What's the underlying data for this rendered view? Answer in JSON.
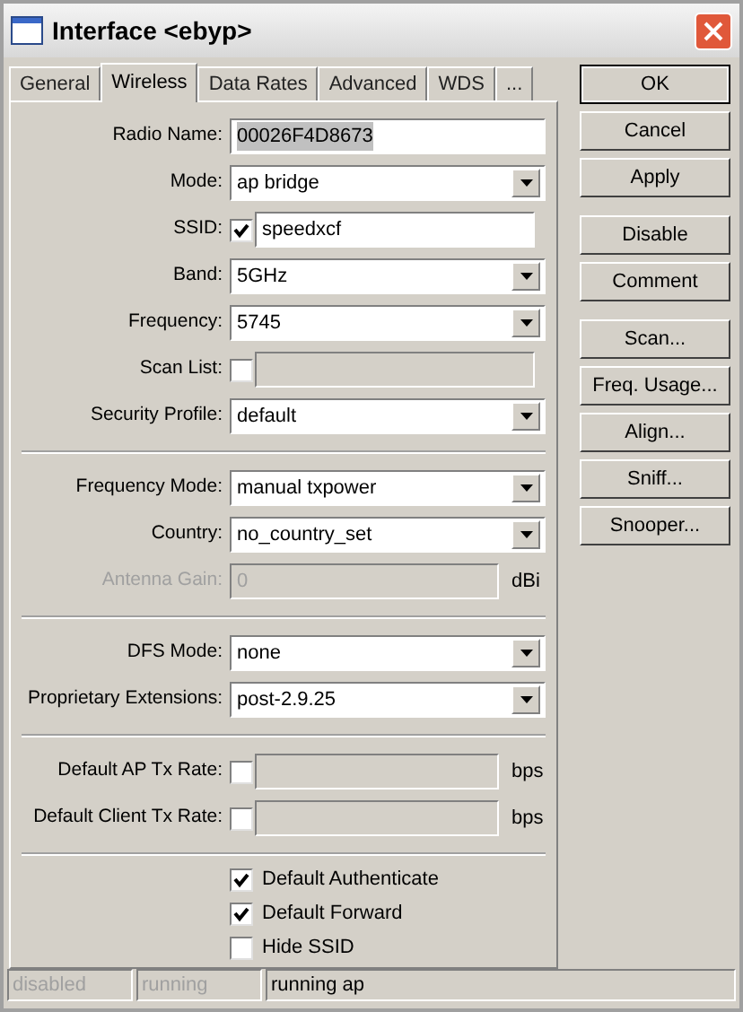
{
  "window": {
    "title": "Interface <ebyp>"
  },
  "tabs": [
    {
      "label": "General",
      "selected": false
    },
    {
      "label": "Wireless",
      "selected": true
    },
    {
      "label": "Data Rates",
      "selected": false
    },
    {
      "label": "Advanced",
      "selected": false
    },
    {
      "label": "WDS",
      "selected": false
    },
    {
      "label": "...",
      "selected": false
    }
  ],
  "sections": [
    [
      {
        "kind": "text",
        "label": "Radio Name:",
        "value": "00026F4D8673",
        "highlighted": true
      },
      {
        "kind": "select",
        "label": "Mode:",
        "value": "ap bridge"
      },
      {
        "kind": "check_text",
        "label": "SSID:",
        "checked": true,
        "value": "speedxcf"
      },
      {
        "kind": "select",
        "label": "Band:",
        "value": "5GHz"
      },
      {
        "kind": "select",
        "label": "Frequency:",
        "value": "5745"
      },
      {
        "kind": "check_text",
        "label": "Scan List:",
        "checked": false
      },
      {
        "kind": "select",
        "label": "Security Profile:",
        "value": "default"
      }
    ],
    [
      {
        "kind": "select",
        "label": "Frequency Mode:",
        "value": "manual txpower"
      },
      {
        "kind": "select",
        "label": "Country:",
        "value": "no_country_set"
      },
      {
        "kind": "unit",
        "label": "Antenna Gain:",
        "value": "0",
        "unit": "dBi",
        "disabled": true
      }
    ],
    [
      {
        "kind": "select",
        "label": "DFS Mode:",
        "value": "none"
      },
      {
        "kind": "select",
        "label": "Proprietary Extensions:",
        "value": "post-2.9.25"
      }
    ],
    [
      {
        "kind": "check_unit",
        "label": "Default AP Tx Rate:",
        "checked": false,
        "unit": "bps"
      },
      {
        "kind": "check_unit",
        "label": "Default Client Tx Rate:",
        "checked": false,
        "unit": "bps"
      }
    ]
  ],
  "options": [
    {
      "label": "Default Authenticate",
      "checked": true
    },
    {
      "label": "Default Forward",
      "checked": true
    },
    {
      "label": "Hide SSID",
      "checked": false
    }
  ],
  "buttons": [
    [
      {
        "label": "OK",
        "default": true
      },
      {
        "label": "Cancel",
        "default": false
      },
      {
        "label": "Apply",
        "default": false
      }
    ],
    [
      {
        "label": "Disable",
        "default": false
      },
      {
        "label": "Comment",
        "default": false
      }
    ],
    [
      {
        "label": "Scan...",
        "default": false
      },
      {
        "label": "Freq. Usage...",
        "default": false
      },
      {
        "label": "Align...",
        "default": false
      },
      {
        "label": "Sniff...",
        "default": false
      },
      {
        "label": "Snooper...",
        "default": false
      }
    ]
  ],
  "status_bar": [
    {
      "text": "disabled",
      "disabled": true
    },
    {
      "text": "running",
      "disabled": true
    },
    {
      "text": "running ap",
      "disabled": false
    }
  ]
}
